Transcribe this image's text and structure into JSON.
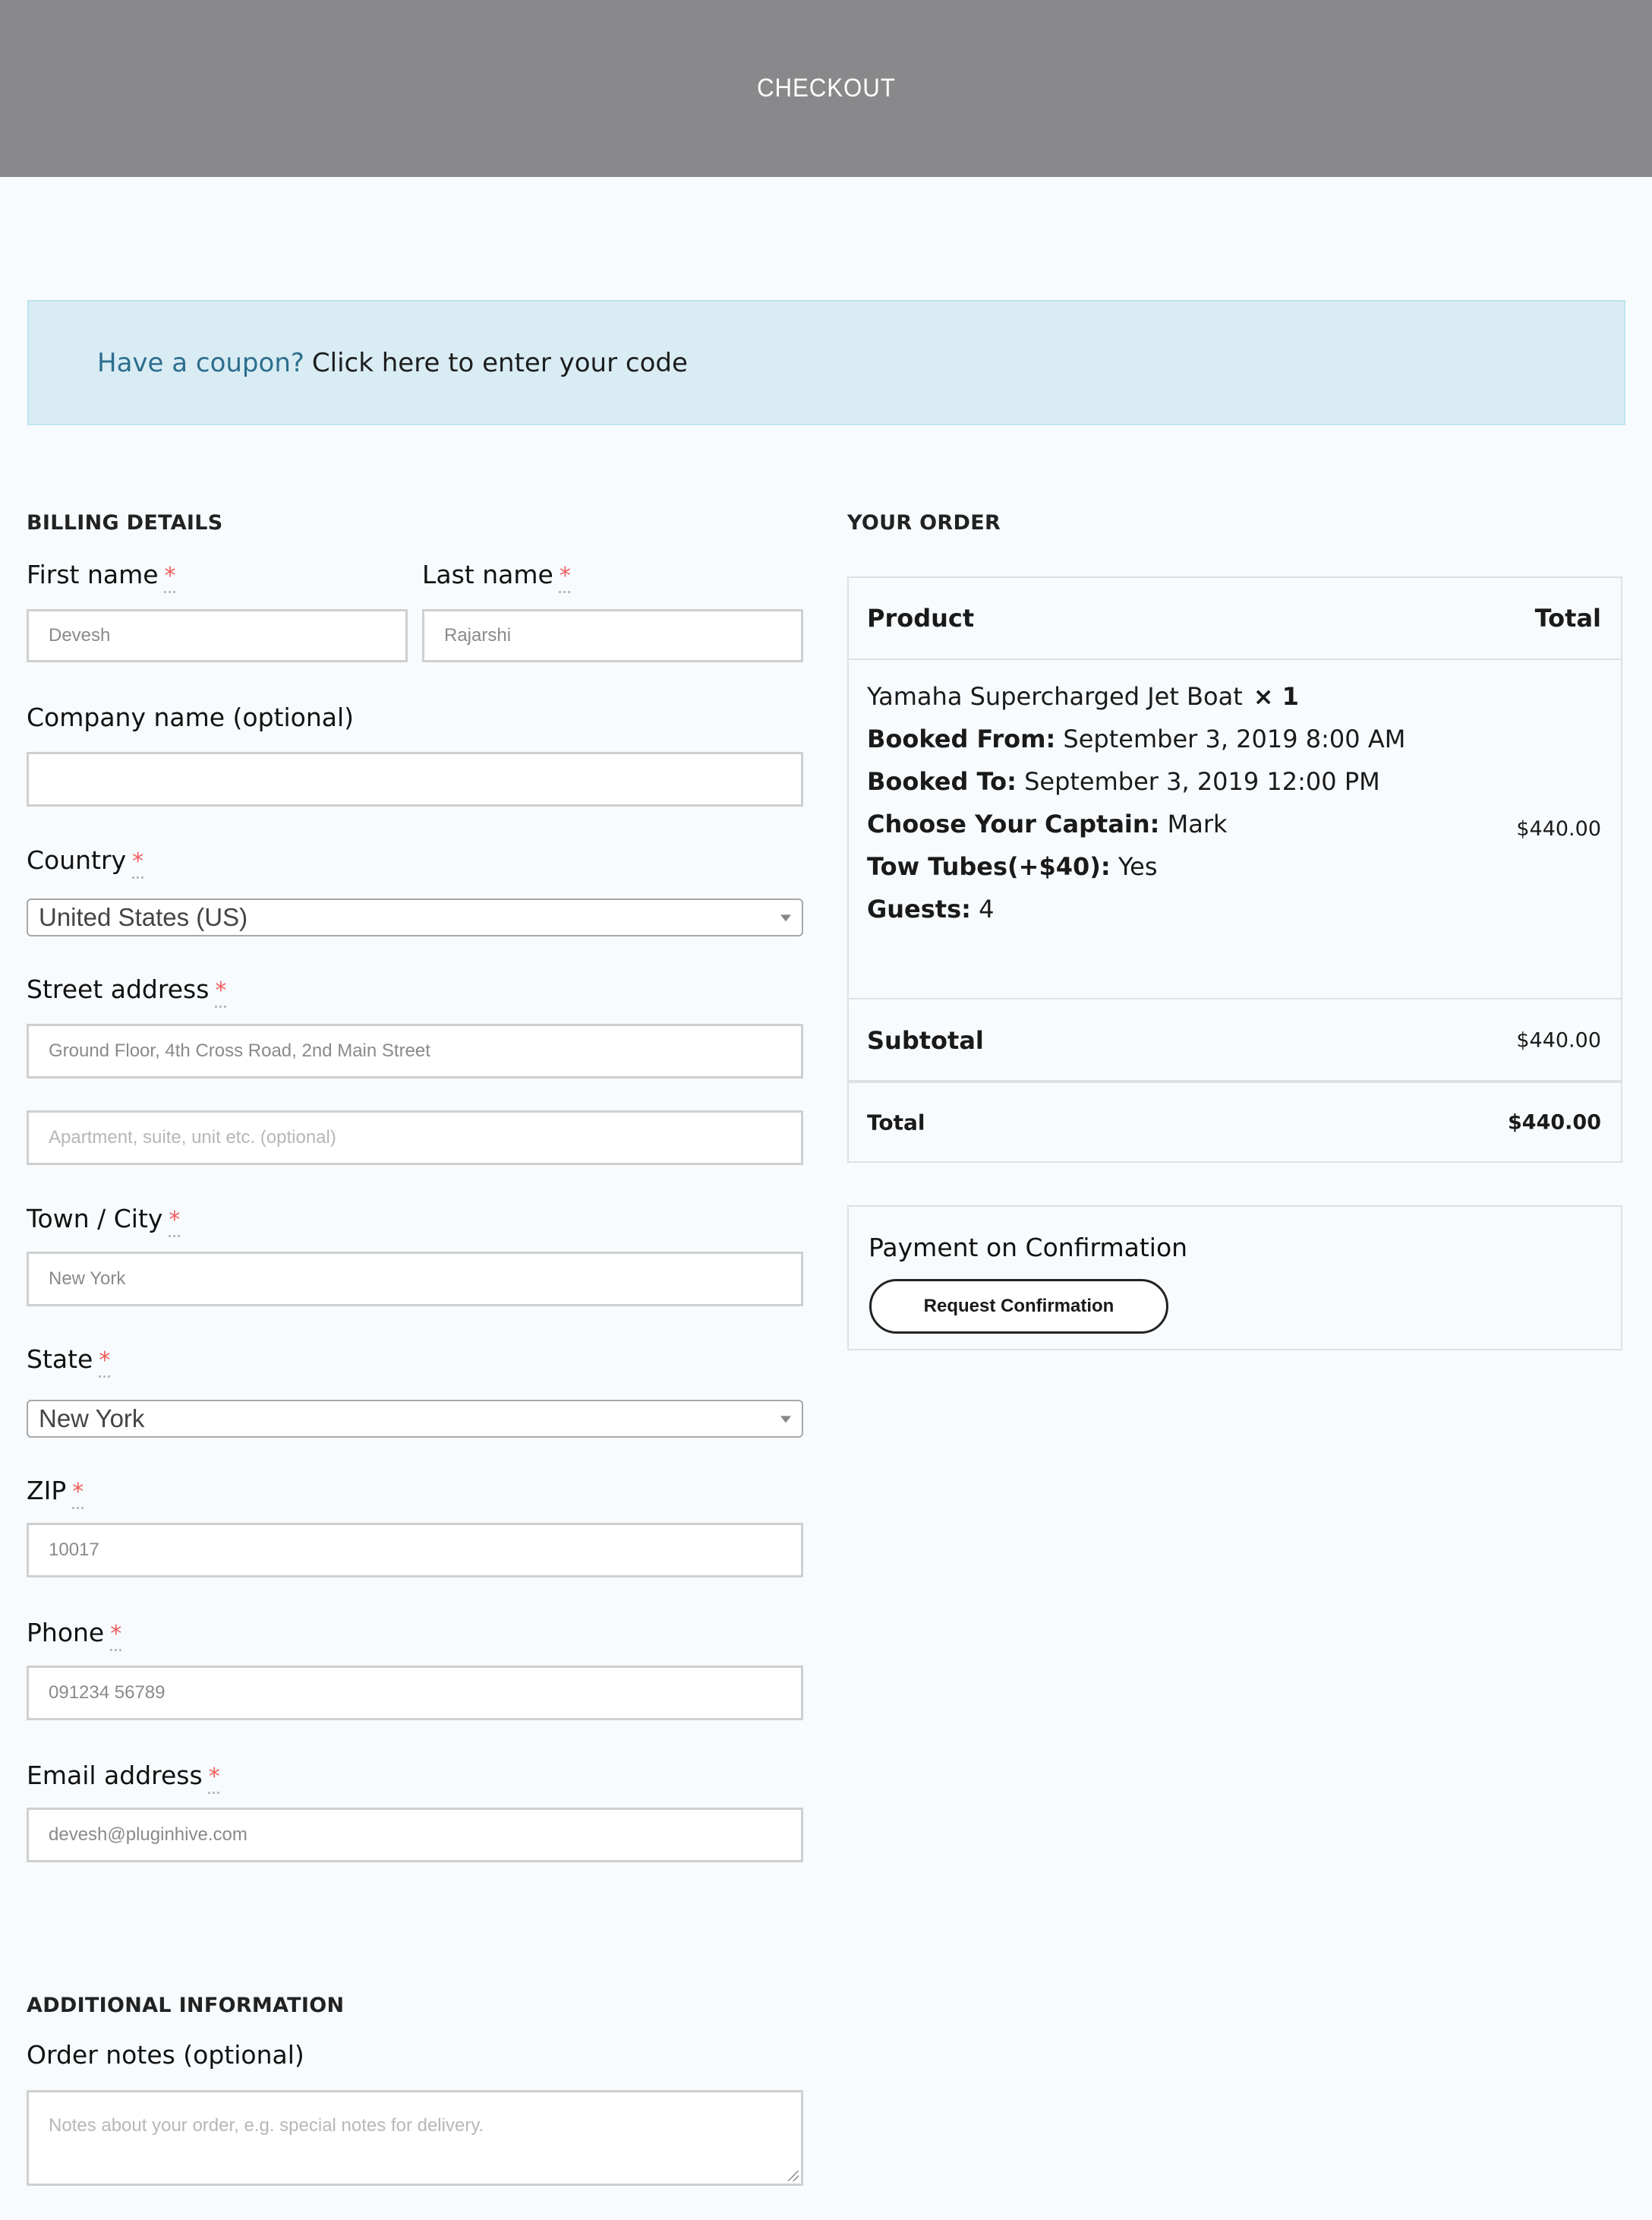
{
  "header": {
    "title": "CHECKOUT"
  },
  "coupon": {
    "question": "Have a coupon?",
    "link_text": "Click here to enter your code",
    "bg_color": "#d9ecf4",
    "question_color": "#2d6e8e"
  },
  "billing": {
    "title": "BILLING DETAILS",
    "required_marker": "*",
    "first_name": {
      "label": "First name",
      "value": "Devesh"
    },
    "last_name": {
      "label": "Last name",
      "value": "Rajarshi"
    },
    "company": {
      "label": "Company name (optional)",
      "value": ""
    },
    "country": {
      "label": "Country",
      "selected": "United States (US)"
    },
    "street": {
      "label": "Street address",
      "line1_value": "Ground Floor, 4th Cross Road, 2nd Main Street",
      "line2_placeholder": "Apartment, suite, unit etc. (optional)"
    },
    "city": {
      "label": "Town / City",
      "value": "New York"
    },
    "state": {
      "label": "State",
      "selected": "New York"
    },
    "zip": {
      "label": "ZIP",
      "value": "10017"
    },
    "phone": {
      "label": "Phone",
      "value": "091234 56789"
    },
    "email": {
      "label": "Email address",
      "value": "devesh@pluginhive.com"
    }
  },
  "additional": {
    "title": "ADDITIONAL INFORMATION",
    "notes_label": "Order notes (optional)",
    "notes_placeholder": "Notes about your order, e.g. special notes for delivery."
  },
  "order": {
    "title": "YOUR ORDER",
    "columns": {
      "product": "Product",
      "total": "Total"
    },
    "item": {
      "name": "Yamaha Supercharged Jet Boat",
      "quantity": "× 1",
      "meta": [
        {
          "key": "Booked From:",
          "value": "September 3, 2019 8:00 AM"
        },
        {
          "key": "Booked To:",
          "value": "September 3, 2019 12:00 PM"
        },
        {
          "key": "Choose Your Captain:",
          "value": "Mark"
        },
        {
          "key": "Tow Tubes(+$40):",
          "value": "Yes"
        },
        {
          "key": "Guests:",
          "value": "4"
        }
      ],
      "price": "$440.00"
    },
    "subtotal": {
      "label": "Subtotal",
      "value": "$440.00"
    },
    "total": {
      "label": "Total",
      "value": "$440.00"
    }
  },
  "payment": {
    "method": "Payment on Confirmation",
    "button_label": "Request Confirmation"
  }
}
